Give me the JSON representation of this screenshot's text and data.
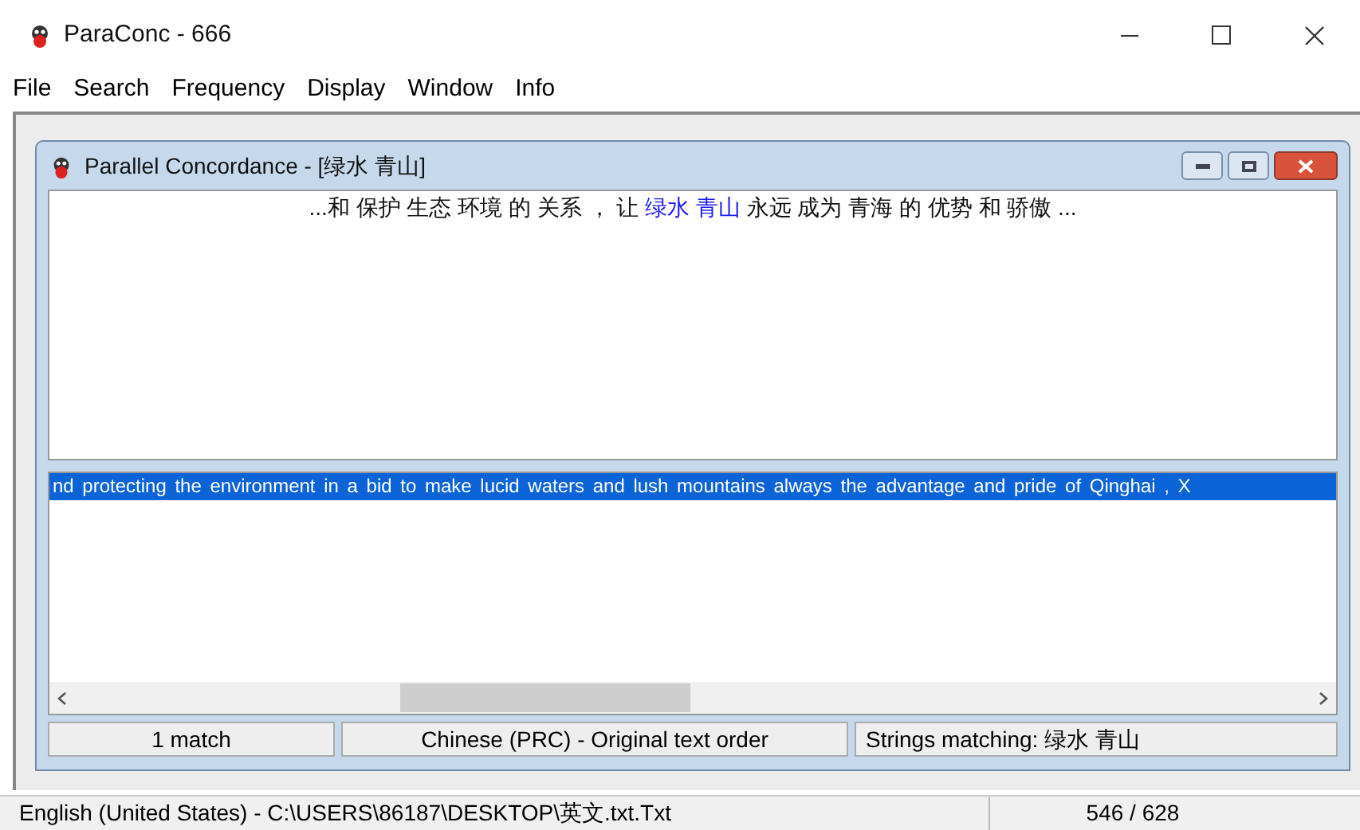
{
  "window": {
    "title": "ParaConc - 666"
  },
  "menu": [
    "File",
    "Search",
    "Frequency",
    "Display",
    "Window",
    "Info"
  ],
  "child_window": {
    "title": "Parallel Concordance - [绿水 青山]",
    "source_line": [
      {
        "kind": "context",
        "text": "...和 保护 生态 环境 的 关系 ， 让 "
      },
      {
        "kind": "hit",
        "text": "绿水 青山"
      },
      {
        "kind": "context",
        "text": " 永远 成为 青海 的 优势 和 骄傲 ..."
      }
    ],
    "target_line": {
      "text": "nd protecting the environment in a bid to make lucid waters and lush mountains always the advantage and pride of Qinghai , X",
      "selected": true
    },
    "status": [
      "1 match",
      "Chinese (PRC) - Original text order",
      "Strings matching: 绿水 青山"
    ]
  },
  "status_bar": [
    "English (United States) - C:\\USERS\\86187\\DESKTOP\\英文.txt.Txt",
    "546 / 628"
  ]
}
